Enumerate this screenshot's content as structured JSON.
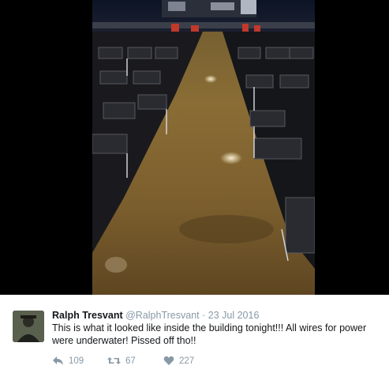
{
  "tweet": {
    "display_name": "Ralph Tresvant",
    "handle": "@RalphTresvant",
    "separator": "·",
    "date": "23 Jul 2016",
    "text": "This is what it looked like inside the building tonight!!! All wires for power were underwater! Pissed off tho!!",
    "replies": "109",
    "retweets": "67",
    "likes": "227"
  },
  "icons": {
    "reply": "reply-icon",
    "retweet": "retweet-icon",
    "like": "heart-icon"
  },
  "colors": {
    "text": "#14171a",
    "muted": "#8899a6",
    "frame": "#000000"
  }
}
